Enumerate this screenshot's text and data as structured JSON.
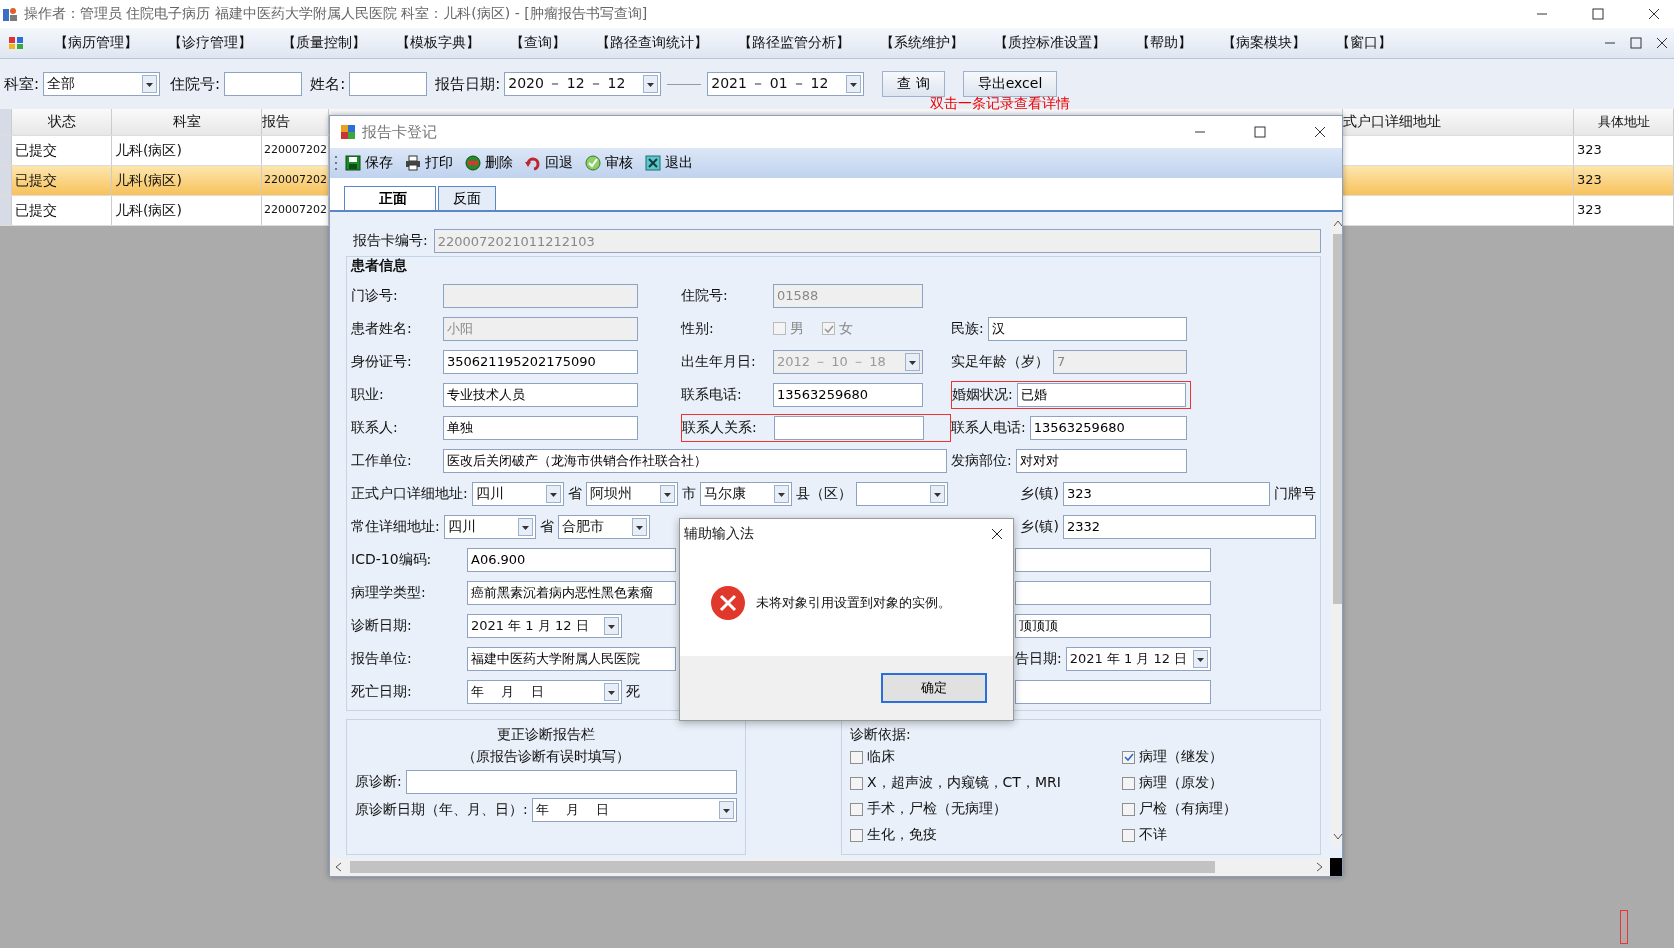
{
  "app": {
    "title": "操作者：管理员 住院电子病历  福建中医药大学附属人民医院  科室：儿科(病区) - [肿瘤报告书写查询]"
  },
  "menu": [
    "【病历管理】",
    "【诊疗管理】",
    "【质量控制】",
    "【模板字典】",
    "【查询】",
    "【路径查询统计】",
    "【路径监管分析】",
    "【系统维护】",
    "【质控标准设置】",
    "【帮助】",
    "【病案模块】",
    "【窗口】"
  ],
  "filter": {
    "items": [
      {
        "kind": "label",
        "text": "科室:"
      },
      {
        "kind": "combo",
        "value": "全部"
      },
      {
        "kind": "label",
        "text": "住院号:"
      },
      {
        "kind": "text"
      },
      {
        "kind": "label",
        "text": "姓名:"
      },
      {
        "kind": "text"
      },
      {
        "kind": "label",
        "text": "报告日期:"
      },
      {
        "kind": "date",
        "value": "2020 － 12 － 12"
      },
      {
        "kind": "separator"
      },
      {
        "kind": "date",
        "value": "2021 － 01 － 12"
      },
      {
        "kind": "button",
        "text": "查 询"
      },
      {
        "kind": "button",
        "text": "导出excel"
      }
    ],
    "hint": "双击一条记录查看详情"
  },
  "table": {
    "columns": [
      "状态",
      "科室",
      "报告",
      "式户口详细地址",
      "具体地址"
    ],
    "rows": [
      {
        "status": "已提交",
        "dept": "儿科(病区)",
        "report_no": "220007202",
        "address": "323",
        "selected": false
      },
      {
        "status": "已提交",
        "dept": "儿科(病区)",
        "report_no": "220007202",
        "address": "323",
        "selected": true
      },
      {
        "status": "已提交",
        "dept": "儿科(病区)",
        "report_no": "220007202",
        "address": "323",
        "selected": false
      }
    ]
  },
  "dialog": {
    "title": "报告卡登记",
    "toolbar": [
      {
        "label": "保存"
      },
      {
        "label": "打印"
      },
      {
        "label": "删除"
      },
      {
        "label": "回退"
      },
      {
        "label": "审核"
      },
      {
        "label": "退出"
      }
    ],
    "tabs": [
      {
        "label": "正面",
        "selected": true
      },
      {
        "label": "反面",
        "selected": false
      }
    ],
    "card_no": {
      "label": "报告卡编号:",
      "value": "2200072021011212103"
    },
    "section": "患者信息",
    "rows": [
      {
        "kind": "triple",
        "cells": [
          {
            "flagged": false,
            "items": [
              {
                "kind": "label",
                "text": "门诊号:"
              },
              {
                "kind": "text",
                "disabled": true
              }
            ]
          },
          {
            "flagged": false,
            "items": [
              {
                "kind": "label",
                "text": "住院号:"
              },
              {
                "kind": "text",
                "value": "01588",
                "disabled": true
              }
            ]
          }
        ]
      },
      {
        "kind": "triple",
        "cells": [
          {
            "flagged": false,
            "items": [
              {
                "kind": "label",
                "text": "患者姓名:"
              },
              {
                "kind": "text",
                "value": "小阳",
                "disabled": true
              }
            ]
          },
          {
            "flagged": false,
            "items": [
              {
                "kind": "label",
                "text": "性别:"
              },
              {
                "kind": "check",
                "text": "男",
                "checked": false,
                "disabled": true
              },
              {
                "kind": "check",
                "text": "女",
                "checked": true,
                "disabled": true
              }
            ]
          },
          {
            "flagged": false,
            "items": [
              {
                "kind": "label",
                "text": "民族:"
              },
              {
                "kind": "text",
                "value": "汉",
                "disabled": false
              }
            ]
          }
        ]
      },
      {
        "kind": "triple",
        "cells": [
          {
            "flagged": false,
            "items": [
              {
                "kind": "label",
                "text": "身份证号:"
              },
              {
                "kind": "text",
                "value": "350621195202175090",
                "disabled": false
              }
            ]
          },
          {
            "flagged": false,
            "items": [
              {
                "kind": "label",
                "text": "出生年月日:"
              },
              {
                "kind": "date",
                "value": "2012 － 10 － 18",
                "disabled": true
              }
            ]
          },
          {
            "flagged": false,
            "items": [
              {
                "kind": "label",
                "text": "实足年龄（岁）"
              },
              {
                "kind": "text",
                "value": "7",
                "disabled": true
              }
            ]
          }
        ]
      },
      {
        "kind": "triple",
        "cells": [
          {
            "flagged": false,
            "items": [
              {
                "kind": "label",
                "text": "职业:"
              },
              {
                "kind": "text",
                "value": "专业技术人员",
                "disabled": false
              }
            ]
          },
          {
            "flagged": false,
            "items": [
              {
                "kind": "label",
                "text": "联系电话:"
              },
              {
                "kind": "text",
                "value": "13563259680",
                "disabled": false
              }
            ]
          },
          {
            "flagged": true,
            "items": [
              {
                "kind": "label",
                "text": "婚姻状况:"
              },
              {
                "kind": "text",
                "value": "已婚",
                "disabled": false
              }
            ]
          }
        ]
      },
      {
        "kind": "triple",
        "cells": [
          {
            "flagged": false,
            "items": [
              {
                "kind": "label",
                "text": "联系人:"
              },
              {
                "kind": "text",
                "value": "单独",
                "disabled": false
              }
            ]
          },
          {
            "flagged": true,
            "items": [
              {
                "kind": "label",
                "text": "联系人关系:"
              },
              {
                "kind": "text",
                "disabled": false
              }
            ]
          },
          {
            "flagged": false,
            "items": [
              {
                "kind": "label",
                "text": "联系人电话:"
              },
              {
                "kind": "text",
                "value": "13563259680",
                "disabled": false
              }
            ]
          }
        ]
      },
      {
        "kind": "wide",
        "cells": [
          {
            "flagged": false,
            "items": [
              {
                "kind": "label",
                "text": "工作单位:"
              },
              {
                "kind": "text",
                "value": "医改后关闭破产（龙海市供销合作社联合社）",
                "disabled": false
              }
            ]
          },
          {
            "flagged": false,
            "items": [
              {
                "kind": "label",
                "text": "发病部位:"
              },
              {
                "kind": "text",
                "value": "对对对",
                "disabled": false
              }
            ]
          }
        ]
      },
      {
        "kind": "address",
        "cells": [
          {
            "flagged": false,
            "items": [
              {
                "kind": "label",
                "text": "正式户口详细地址:"
              },
              {
                "kind": "combo",
                "value": "四川"
              },
              {
                "kind": "label",
                "text": "省"
              },
              {
                "kind": "combo",
                "value": "阿坝州"
              },
              {
                "kind": "label",
                "text": "市"
              },
              {
                "kind": "combo",
                "value": "马尔康"
              },
              {
                "kind": "label",
                "text": "县（区）"
              },
              {
                "kind": "combo"
              }
            ]
          },
          {
            "flagged": false,
            "items": [
              {
                "kind": "label",
                "text": "乡(镇)"
              },
              {
                "kind": "text",
                "value": "323",
                "disabled": false
              },
              {
                "kind": "label",
                "text": "门牌号"
              }
            ]
          }
        ]
      },
      {
        "kind": "address",
        "cells": [
          {
            "flagged": false,
            "items": [
              {
                "kind": "label",
                "text": "常住详细地址:"
              },
              {
                "kind": "combo",
                "value": "四川"
              },
              {
                "kind": "label",
                "text": "省"
              },
              {
                "kind": "combo",
                "value": "合肥市"
              }
            ]
          },
          {
            "flagged": false,
            "items": [
              {
                "kind": "label",
                "text": "乡(镇)"
              },
              {
                "kind": "text",
                "value": "2332",
                "disabled": false
              }
            ]
          }
        ]
      },
      {
        "kind": "pair",
        "cells": [
          {
            "flagged": false,
            "items": [
              {
                "kind": "label",
                "text": "ICD-10编码:"
              },
              {
                "kind": "text",
                "value": "A06.900",
                "disabled": false
              }
            ]
          },
          {
            "flagged": false,
            "items": [
              {
                "kind": "text",
                "disabled": false
              }
            ]
          }
        ]
      },
      {
        "kind": "pair",
        "cells": [
          {
            "flagged": false,
            "items": [
              {
                "kind": "label",
                "text": "病理学类型:"
              },
              {
                "kind": "text",
                "value": "癌前黑素沉着病内恶性黑色素瘤",
                "disabled": false
              }
            ]
          },
          {
            "flagged": false,
            "items": [
              {
                "kind": "text",
                "disabled": false
              }
            ]
          }
        ]
      },
      {
        "kind": "pair",
        "cells": [
          {
            "flagged": false,
            "items": [
              {
                "kind": "label",
                "text": "诊断日期:"
              },
              {
                "kind": "date",
                "value": "2021 年 1 月 12 日",
                "disabled": false
              }
            ]
          },
          {
            "flagged": false,
            "items": [
              {
                "kind": "text",
                "value": "顶顶顶",
                "disabled": false
              }
            ]
          }
        ]
      },
      {
        "kind": "pair",
        "cells": [
          {
            "flagged": false,
            "items": [
              {
                "kind": "label",
                "text": "报告单位:"
              },
              {
                "kind": "text",
                "value": "福建中医药大学附属人民医院",
                "disabled": false
              }
            ]
          },
          {
            "flagged": false,
            "items": [
              {
                "kind": "label",
                "text": "告日期:"
              },
              {
                "kind": "date",
                "value": "2021 年 1 月 12 日",
                "disabled": false
              }
            ]
          }
        ]
      },
      {
        "kind": "pair",
        "cells": [
          {
            "flagged": false,
            "items": [
              {
                "kind": "label",
                "text": "死亡日期:"
              },
              {
                "kind": "date",
                "value": "年　 月　 日",
                "disabled": false
              },
              {
                "kind": "label",
                "text": "死"
              }
            ]
          },
          {
            "flagged": false,
            "items": [
              {
                "kind": "text",
                "disabled": false
              }
            ]
          }
        ]
      }
    ],
    "correction": {
      "title": "更正诊断报告栏",
      "subtitle": "（原报告诊断有误时填写）",
      "diag_label": "原诊断:",
      "date_label": "原诊断日期（年、月、日）:",
      "date_value": "年　 月　 日"
    },
    "basis": {
      "title": "诊断依据:",
      "options": [
        {
          "label": "临床",
          "checked": false
        },
        {
          "label": "X，超声波，内窥镜，CT，MRI",
          "checked": false
        },
        {
          "label": "手术，尸检（无病理）",
          "checked": false
        },
        {
          "label": "生化，免疫",
          "checked": false
        },
        {
          "label": "病理（继发）",
          "checked": true
        },
        {
          "label": "病理（原发）",
          "checked": false
        },
        {
          "label": "尸检（有病理）",
          "checked": false
        },
        {
          "label": "不详",
          "checked": false
        }
      ]
    }
  },
  "message_box": {
    "title": "辅助输入法",
    "message": "未将对象引用设置到对象的实例。",
    "button": "确定"
  }
}
